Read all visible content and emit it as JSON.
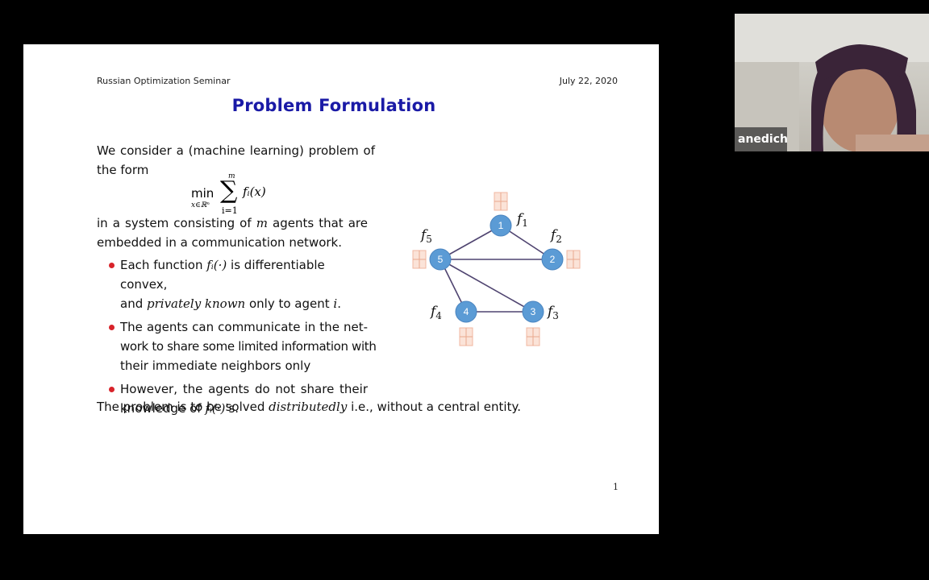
{
  "slide": {
    "header_left": "Russian Optimization Seminar",
    "header_right": "July 22, 2020",
    "title": "Problem Formulation",
    "intro_line1": "We consider a (machine learning) problem of",
    "intro_line2": "the form",
    "formula": {
      "operator": "min",
      "subscript": "x∈ℝⁿ",
      "sum_upper": "m",
      "sum_lower": "i=1",
      "term": "fᵢ(x)"
    },
    "para2_a": "in a system consisting of ",
    "para2_m": "m",
    "para2_b": " agents that are",
    "para2_line2": "embedded in a communication network.",
    "bullets": [
      {
        "line1_a": "Each function ",
        "line1_math": "fᵢ(·)",
        "line1_b": " is differentiable convex,",
        "line2_a": "and ",
        "line2_em": "privately known",
        "line2_b": " only to agent ",
        "line2_math": "i",
        "line2_c": "."
      },
      {
        "line1": "The agents can communicate in the net-",
        "line2": "work to share some limited information with",
        "line3": "their immediate neighbors only"
      },
      {
        "line1": "However, the agents do not share their",
        "line2_a": "knowledge of ",
        "line2_math": "fᵢ(·)",
        "line2_b": "'s."
      }
    ],
    "closing_a": "The problem is to be solved ",
    "closing_em": "distributedly",
    "closing_b": " i.e., without a central entity.",
    "page_number": "1",
    "graph": {
      "node_color": "#5b9bd5",
      "edge_color": "#4f4470",
      "nodes": [
        {
          "id": "1",
          "label": "f",
          "sub": "1"
        },
        {
          "id": "2",
          "label": "f",
          "sub": "2"
        },
        {
          "id": "3",
          "label": "f",
          "sub": "3"
        },
        {
          "id": "4",
          "label": "f",
          "sub": "4"
        },
        {
          "id": "5",
          "label": "f",
          "sub": "5"
        }
      ],
      "edges": [
        [
          "1",
          "5"
        ],
        [
          "1",
          "2"
        ],
        [
          "5",
          "2"
        ],
        [
          "5",
          "4"
        ],
        [
          "5",
          "3"
        ],
        [
          "4",
          "3"
        ]
      ]
    }
  },
  "video": {
    "participant_name": "anedich"
  },
  "colors": {
    "title": "#1a1aa6",
    "bullet": "#d8232a"
  }
}
